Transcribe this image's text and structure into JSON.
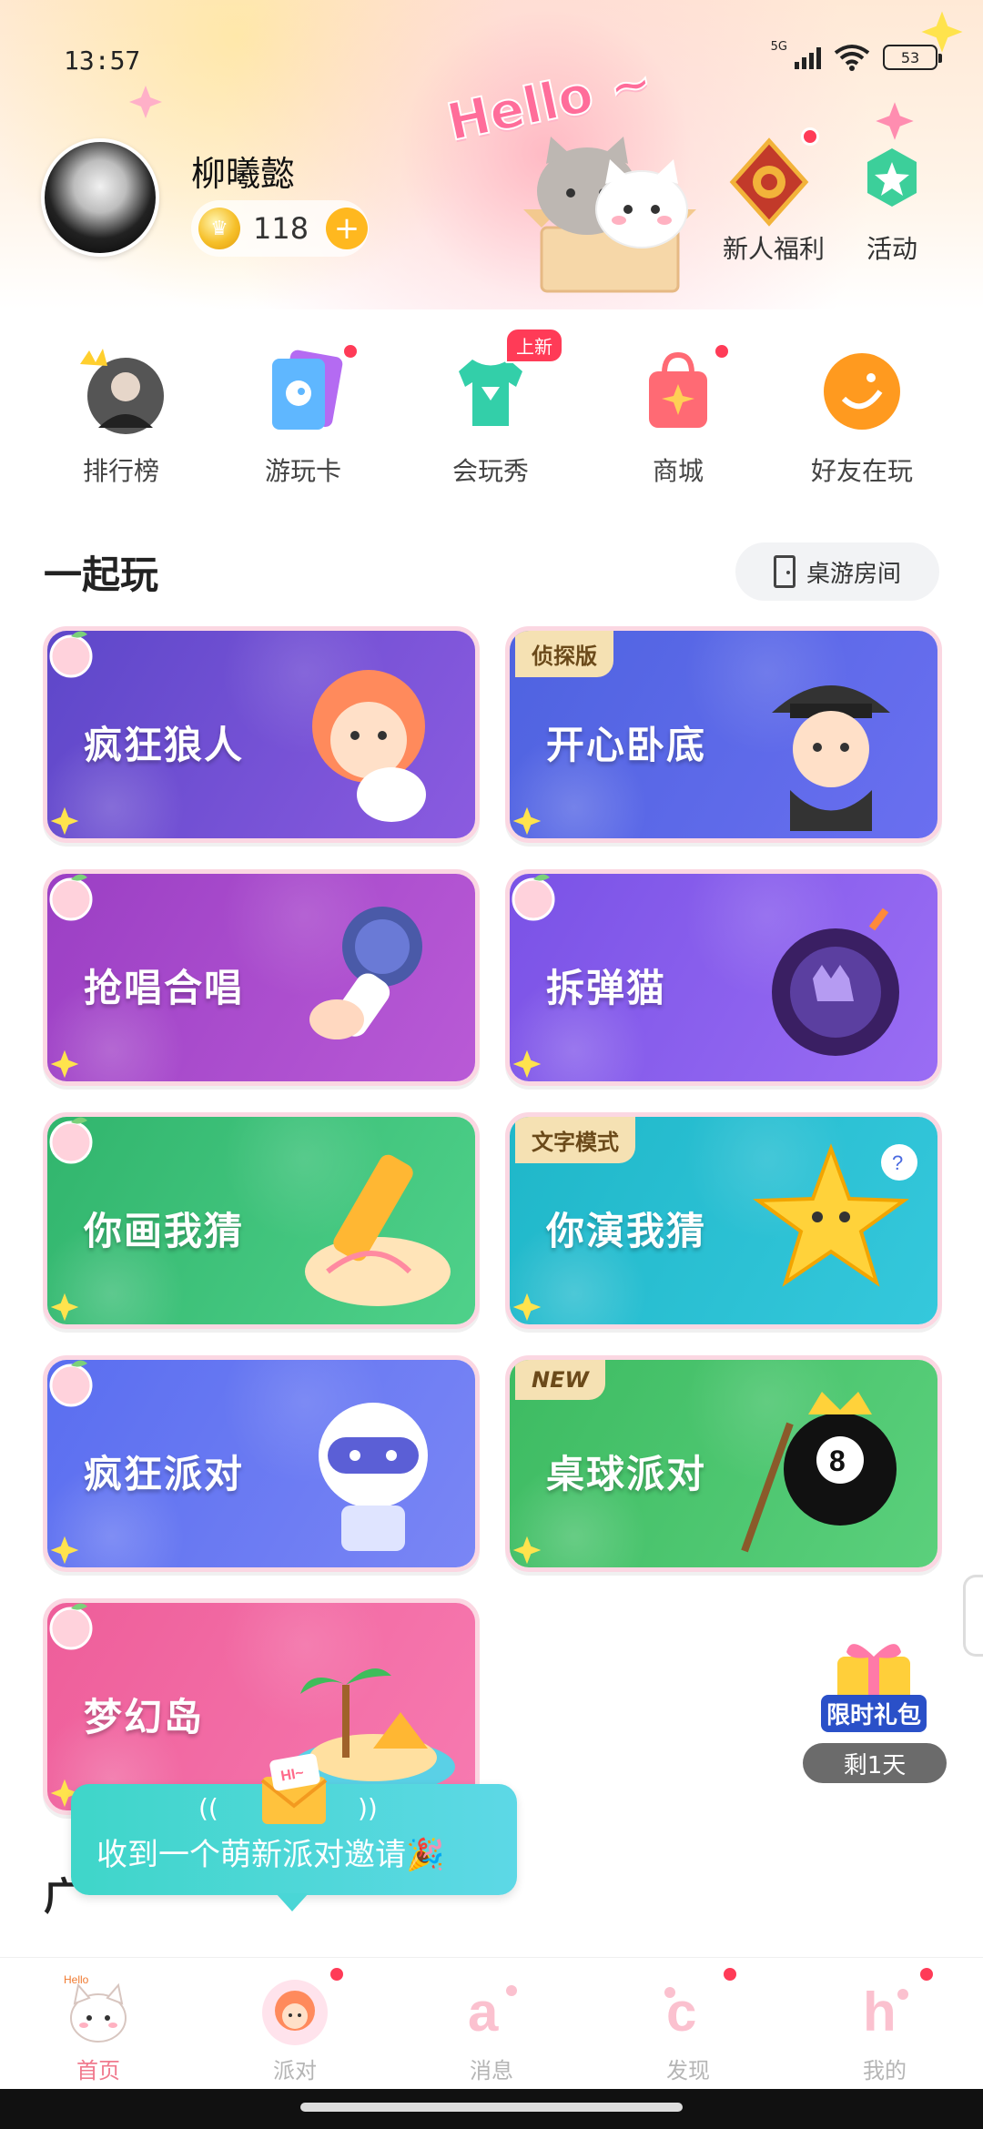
{
  "status": {
    "time": "13:57",
    "network": "5G",
    "battery": "53"
  },
  "profile": {
    "name": "柳曦懿",
    "coins": "118"
  },
  "header": {
    "hello": "Hello ~",
    "welfare_label": "新人福利",
    "activity_label": "活动"
  },
  "shortcuts": [
    {
      "label": "排行榜",
      "icon": "leaderboard-avatar-icon"
    },
    {
      "label": "游玩卡",
      "icon": "play-card-icon"
    },
    {
      "label": "会玩秀",
      "icon": "tshirt-icon",
      "badge": "上新"
    },
    {
      "label": "商城",
      "icon": "shopping-bag-icon"
    },
    {
      "label": "好友在玩",
      "icon": "smiley-icon"
    }
  ],
  "section": {
    "title": "一起玩",
    "room_button": "桌游房间"
  },
  "games": [
    {
      "title": "疯狂狼人",
      "tag": "",
      "color_a": "#5d47c9",
      "color_b": "#8b5be0"
    },
    {
      "title": "开心卧底",
      "tag": "侦探版",
      "color_a": "#4e63e0",
      "color_b": "#6a6ff0"
    },
    {
      "title": "抢唱合唱",
      "tag": "",
      "color_a": "#9b3fc4",
      "color_b": "#b95ad6"
    },
    {
      "title": "拆弹猫",
      "tag": "",
      "color_a": "#7a52e6",
      "color_b": "#9a6df4"
    },
    {
      "title": "你画我猜",
      "tag": "",
      "color_a": "#31b56d",
      "color_b": "#4fd18a"
    },
    {
      "title": "你演我猜",
      "tag": "文字模式",
      "color_a": "#1fb7c9",
      "color_b": "#35c8dc"
    },
    {
      "title": "疯狂派对",
      "tag": "",
      "color_a": "#5a6ef0",
      "color_b": "#7a86f5"
    },
    {
      "title": "桌球派对",
      "tag": "NEW",
      "color_a": "#3dbb62",
      "color_b": "#5bd07c"
    },
    {
      "title": "梦幻岛",
      "tag": "",
      "color_a": "#ee5e9a",
      "color_b": "#f77ab0"
    }
  ],
  "gift": {
    "label": "限时礼包",
    "timer": "剩1天"
  },
  "invite": {
    "text": "收到一个萌新派对邀请🎉",
    "stub": "广",
    "envelope": "HI~"
  },
  "tabs": [
    {
      "label": "首页",
      "icon": "home-cat-icon",
      "dot": false,
      "active": true
    },
    {
      "label": "派对",
      "icon": "party-avatar-icon",
      "dot": true,
      "active": false
    },
    {
      "label": "消息",
      "icon": "message-a-icon",
      "dot": false,
      "active": false
    },
    {
      "label": "发现",
      "icon": "discover-c-icon",
      "dot": true,
      "active": false
    },
    {
      "label": "我的",
      "icon": "profile-h-icon",
      "dot": true,
      "active": false
    }
  ]
}
